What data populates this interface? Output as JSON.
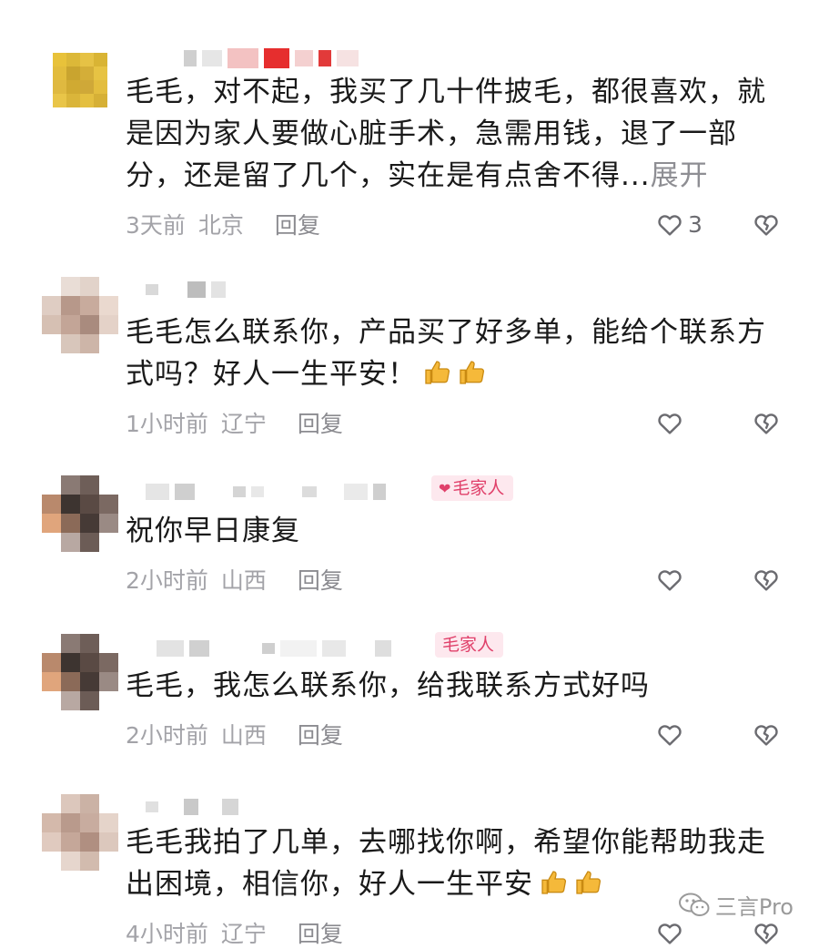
{
  "comments": [
    {
      "text": "毛毛，对不起，我买了几十件披毛，都很喜欢，就是因为家人要做心脏手术，急需用钱，退了一部分，还是留了几个，实在是有点舍不得...",
      "expand_label": "展开",
      "time": "3天前",
      "location": "北京",
      "reply_label": "回复",
      "like_count": "3"
    },
    {
      "text": "毛毛怎么联系你，产品买了好多单，能给个联系方式吗？好人一生平安！",
      "time": "1小时前",
      "location": "辽宁",
      "reply_label": "回复",
      "like_count": ""
    },
    {
      "badge": "毛家人",
      "text": "祝你早日康复",
      "time": "2小时前",
      "location": "山西",
      "reply_label": "回复",
      "like_count": ""
    },
    {
      "badge": "毛家人",
      "text": "毛毛，我怎么联系你，给我联系方式好吗",
      "time": "2小时前",
      "location": "山西",
      "reply_label": "回复",
      "like_count": ""
    },
    {
      "text": "毛毛我拍了几单，去哪找你啊，希望你能帮助我走出困境，相信你，好人一生平安",
      "time": "4小时前",
      "location": "辽宁",
      "reply_label": "回复",
      "like_count": ""
    }
  ],
  "watermark": {
    "text": "三言Pro",
    "icon": "wechat-icon"
  },
  "icons": {
    "like": "heart-outline-icon",
    "dislike": "broken-heart-icon",
    "emoji": "thumbs-up-emoji"
  },
  "colors": {
    "text": "#1a1a1a",
    "meta": "#a3a3a8",
    "badge_bg": "#fde8ee",
    "badge_fg": "#e0406a"
  }
}
